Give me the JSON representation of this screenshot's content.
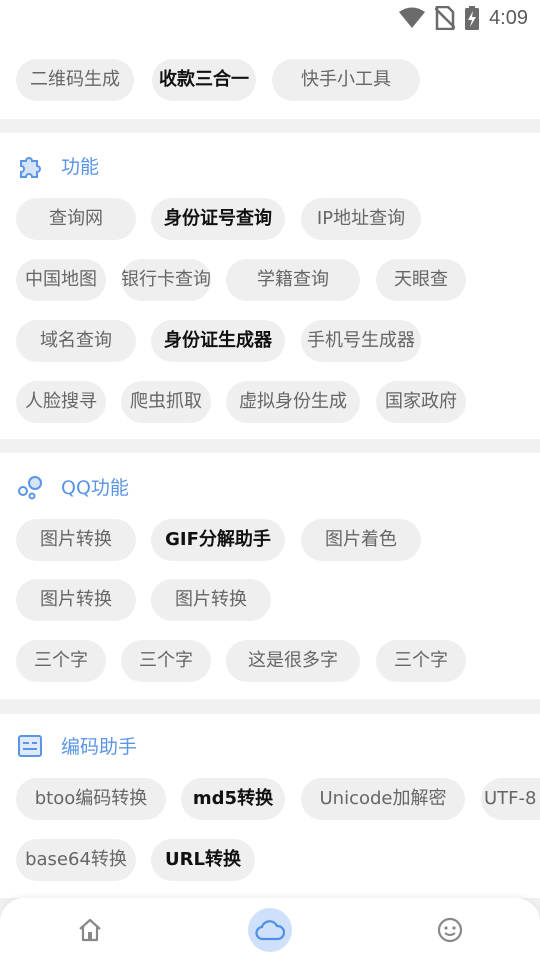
{
  "colors": {
    "accent": "#5b95e6",
    "chip_bg": "#efefef",
    "chip_text": "#666666",
    "chip_bold_text": "#111111"
  },
  "status": {
    "time": "4:09",
    "icons": [
      "wifi-icon",
      "no-sim-icon",
      "battery-charging-icon"
    ]
  },
  "top_section": {
    "chips": [
      {
        "label": "二维码生成",
        "bold": false
      },
      {
        "label": "收款三合一",
        "bold": true
      },
      {
        "label": "快手小工具",
        "bold": false
      }
    ]
  },
  "features": {
    "title": "功能",
    "icon": "puzzle-icon",
    "chips": [
      {
        "label": "查询网",
        "bold": false
      },
      {
        "label": "身份证号查询",
        "bold": true
      },
      {
        "label": "IP地址查询",
        "bold": false
      },
      {
        "label": "中国地图",
        "bold": false
      },
      {
        "label": "银行卡查询",
        "bold": false
      },
      {
        "label": "学籍查询",
        "bold": false
      },
      {
        "label": "天眼查",
        "bold": false
      },
      {
        "label": "域名查询",
        "bold": false
      },
      {
        "label": "身份证生成器",
        "bold": true
      },
      {
        "label": "手机号生成器",
        "bold": false
      },
      {
        "label": "人脸搜寻",
        "bold": false
      },
      {
        "label": "爬虫抓取",
        "bold": false
      },
      {
        "label": "虚拟身份生成",
        "bold": false
      },
      {
        "label": "国家政府",
        "bold": false
      }
    ]
  },
  "qq": {
    "title": "QQ功能",
    "icon": "bubbles-icon",
    "chips": [
      {
        "label": "图片转换",
        "bold": false
      },
      {
        "label": "GIF分解助手",
        "bold": true
      },
      {
        "label": "图片着色",
        "bold": false
      },
      {
        "label": "图片转换",
        "bold": false
      },
      {
        "label": "图片转换",
        "bold": false
      },
      {
        "label": "三个字",
        "bold": false
      },
      {
        "label": "三个字",
        "bold": false
      },
      {
        "label": "这是很多字",
        "bold": false
      },
      {
        "label": "三个字",
        "bold": false
      }
    ]
  },
  "encoding": {
    "title": "编码助手",
    "icon": "code-card-icon",
    "chips": [
      {
        "label": "btoo编码转换",
        "bold": false
      },
      {
        "label": "md5转换",
        "bold": true
      },
      {
        "label": "Unicode加解密",
        "bold": false
      },
      {
        "label": "UTF-8",
        "bold": false
      },
      {
        "label": "base64转换",
        "bold": false
      },
      {
        "label": "URL转换",
        "bold": true
      }
    ]
  },
  "nav": {
    "items": [
      "home-icon",
      "cloud-icon",
      "smile-icon"
    ],
    "active": "cloud-icon"
  }
}
